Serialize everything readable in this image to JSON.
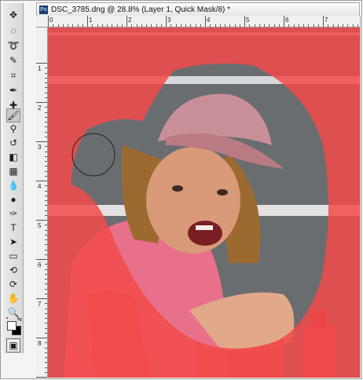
{
  "document": {
    "title": "DSC_3785.dng @ 28.8% (Layer 1, Quick Mask/8) *",
    "app_icon": "Ps"
  },
  "rulers": {
    "top": [
      "0",
      "1",
      "2",
      "3",
      "4",
      "5",
      "6",
      "7"
    ],
    "left": [
      "1",
      "2",
      "3",
      "4",
      "5",
      "6",
      "7",
      "8"
    ]
  },
  "toolbox": {
    "tools": [
      "move-tool-icon",
      "elliptical-marquee-icon",
      "lasso-icon",
      "quick-selection-icon",
      "crop-icon",
      "eyedropper-icon",
      "healing-brush-icon",
      "brush-icon",
      "clone-stamp-icon",
      "history-brush-icon",
      "eraser-icon",
      "gradient-icon",
      "blur-icon",
      "dodge-icon",
      "pen-icon",
      "type-icon",
      "path-selection-icon",
      "rectangle-shape-icon",
      "3d-rotate-icon",
      "3d-orbit-icon",
      "hand-icon",
      "zoom-icon"
    ],
    "active_tool": "brush-icon",
    "foreground_color": "#ffffff",
    "background_color": "#000000",
    "mode_icon": "quick-mask-mode-icon"
  },
  "canvas": {
    "mask_color": "#f24a4a",
    "zoom": "28.8%"
  }
}
